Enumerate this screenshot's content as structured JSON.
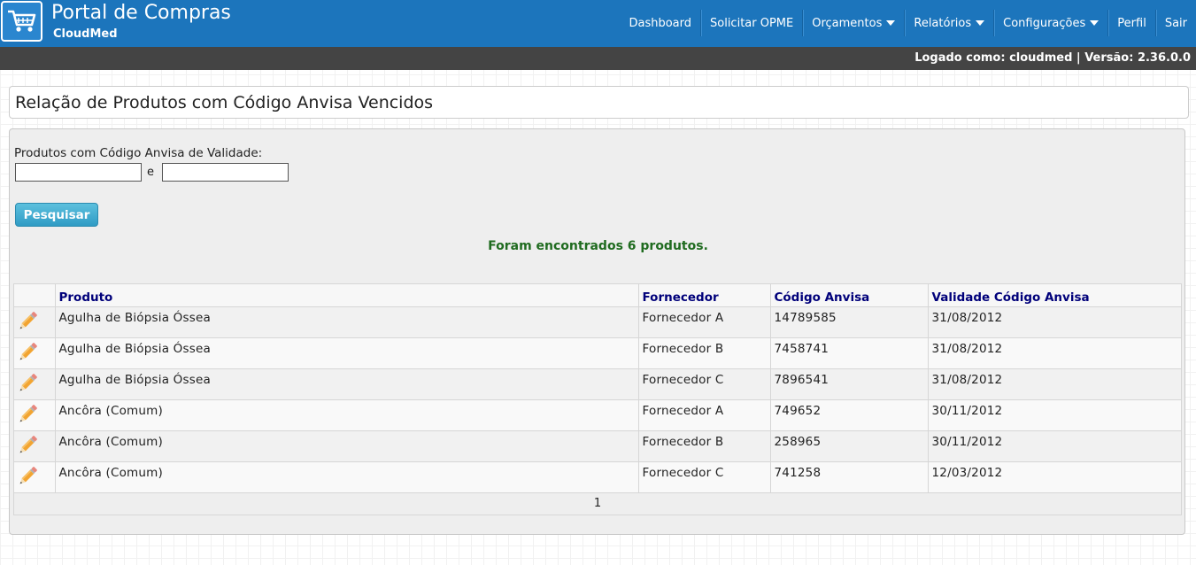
{
  "header": {
    "brand_title": "Portal de Compras",
    "brand_subtitle": "CloudMed",
    "logo_icon": "shopping-cart-icon",
    "nav": [
      {
        "label": "Dashboard",
        "dropdown": false
      },
      {
        "label": "Solicitar OPME",
        "dropdown": false
      },
      {
        "label": "Orçamentos",
        "dropdown": true
      },
      {
        "label": "Relatórios",
        "dropdown": true
      },
      {
        "label": "Configurações",
        "dropdown": true
      },
      {
        "label": "Perfil",
        "dropdown": false
      },
      {
        "label": "Sair",
        "dropdown": false
      }
    ],
    "colors": {
      "navbar": "#1c75bc",
      "statusbar": "#444444"
    }
  },
  "status": {
    "text": "Logado como: cloudmed | Versão: 2.36.0.0"
  },
  "page": {
    "title": "Relação de Produtos com Código Anvisa Vencidos"
  },
  "filter": {
    "label": "Produtos com Código Anvisa de Validade:",
    "start_value": "",
    "separator": "e",
    "end_value": "",
    "search_label": "Pesquisar"
  },
  "result": {
    "message": "Foram encontrados 6 produtos."
  },
  "table": {
    "columns": [
      "",
      "Produto",
      "Fornecedor",
      "Código Anvisa",
      "Validade Código Anvisa"
    ],
    "row_icon": "pencil-edit-icon",
    "rows": [
      {
        "produto": "Agulha de Biópsia Óssea",
        "fornecedor": "Fornecedor A",
        "codigo": "14789585",
        "validade": "31/08/2012"
      },
      {
        "produto": "Agulha de Biópsia Óssea",
        "fornecedor": "Fornecedor B",
        "codigo": "7458741",
        "validade": "31/08/2012"
      },
      {
        "produto": "Agulha de Biópsia Óssea",
        "fornecedor": "Fornecedor C",
        "codigo": "7896541",
        "validade": "31/08/2012"
      },
      {
        "produto": "Ancôra (Comum)",
        "fornecedor": "Fornecedor A",
        "codigo": "749652",
        "validade": "30/11/2012"
      },
      {
        "produto": "Ancôra (Comum)",
        "fornecedor": "Fornecedor B",
        "codigo": "258965",
        "validade": "30/11/2012"
      },
      {
        "produto": "Ancôra (Comum)",
        "fornecedor": "Fornecedor C",
        "codigo": "741258",
        "validade": "12/03/2012"
      }
    ],
    "pager": "1"
  }
}
